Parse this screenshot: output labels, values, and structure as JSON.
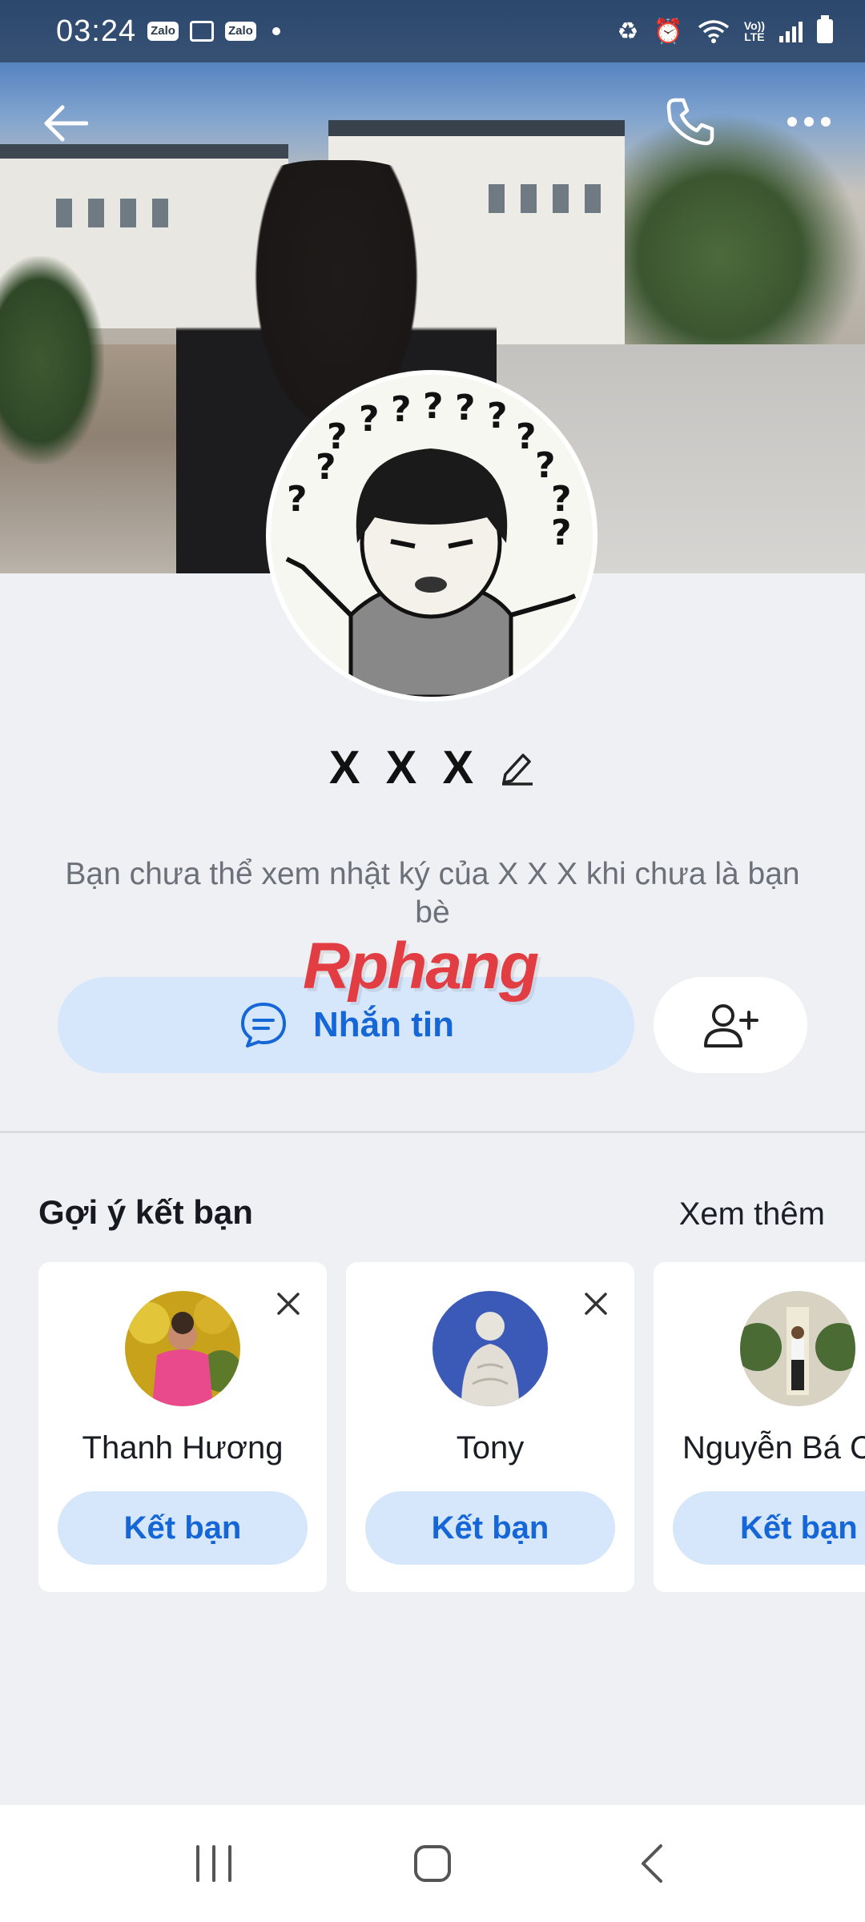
{
  "status_bar": {
    "time": "03:24",
    "app_badges": [
      "Zalo",
      "Zalo"
    ],
    "volte_label": "Vo))\nLTE"
  },
  "header": {
    "back_icon": "arrow-left-icon",
    "call_icon": "phone-icon",
    "more_icon": "more-dots-icon"
  },
  "profile": {
    "name": "X X X",
    "diary_note": "Bạn chưa thể xem nhật ký của X X X khi chưa là bạn bè",
    "message_button_label": "Nhắn tin",
    "add_friend_icon": "add-user-icon"
  },
  "watermark": {
    "text": "Rphang"
  },
  "suggestions": {
    "title": "Gợi ý kết bạn",
    "see_more_label": "Xem thêm",
    "items": [
      {
        "name": "Thanh Hương",
        "add_label": "Kết bạn"
      },
      {
        "name": "Tony",
        "add_label": "Kết bạn"
      },
      {
        "name": "Nguyễn Bá C",
        "add_label": "Kết bạn"
      }
    ]
  },
  "colors": {
    "accent": "#1566d6",
    "accent_soft": "#d6e6fb",
    "background": "#eef0f4"
  }
}
